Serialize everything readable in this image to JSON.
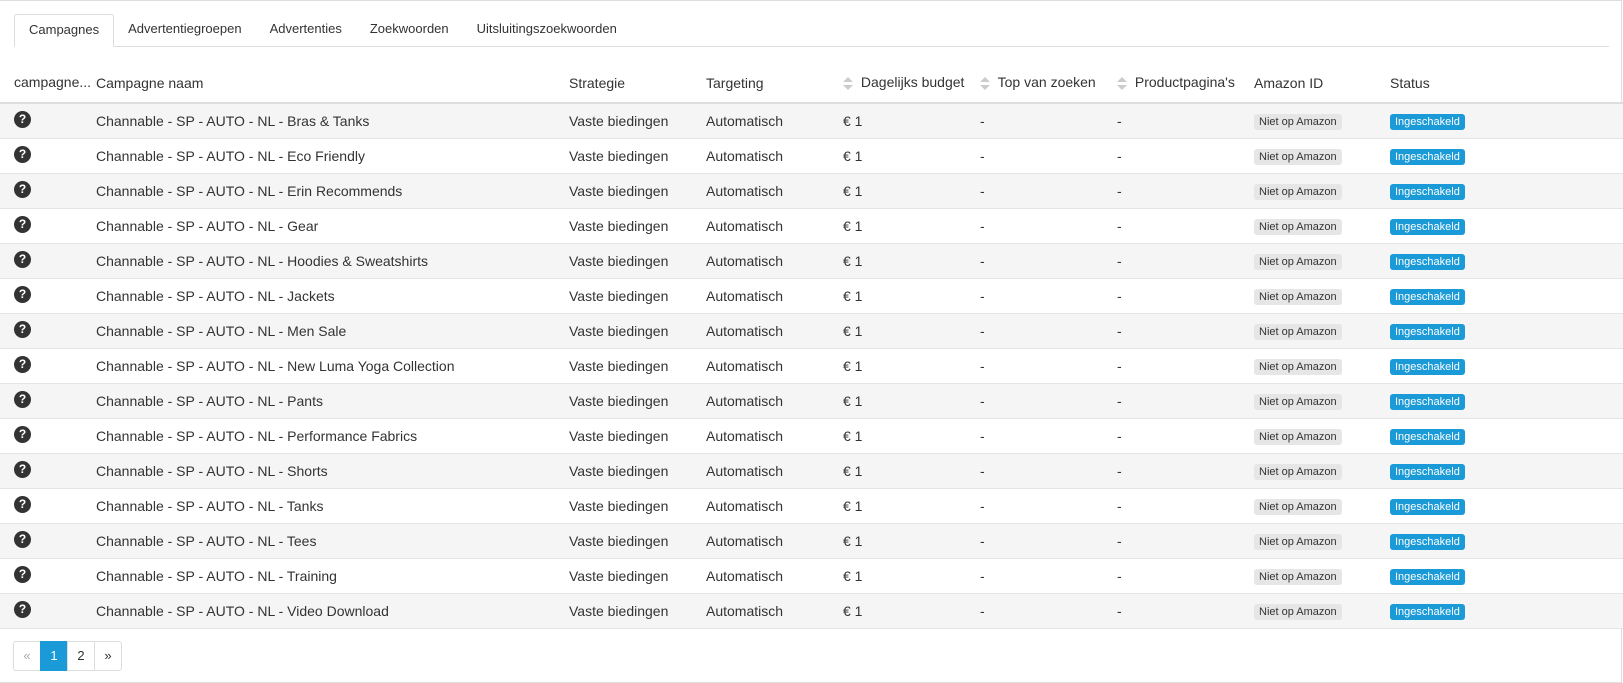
{
  "tabs": [
    "Campagnes",
    "Advertentiegroepen",
    "Advertenties",
    "Zoekwoorden",
    "Uitsluitingszoekwoorden"
  ],
  "active_tab": 0,
  "table": {
    "headers": {
      "type": "campagne...",
      "name": "Campagne naam",
      "strategy": "Strategie",
      "targeting": "Targeting",
      "budget": "Dagelijks budget",
      "top": "Top van zoeken",
      "product": "Productpagina's",
      "amazon": "Amazon ID",
      "status": "Status"
    },
    "rows": [
      {
        "icon": "?",
        "name": "Channable - SP - AUTO - NL - Bras & Tanks",
        "strategy": "Vaste biedingen",
        "targeting": "Automatisch",
        "budget": "€ 1",
        "top": "-",
        "product": "-",
        "amazon": "Niet op Amazon",
        "status": "Ingeschakeld"
      },
      {
        "icon": "?",
        "name": "Channable - SP - AUTO - NL - Eco Friendly",
        "strategy": "Vaste biedingen",
        "targeting": "Automatisch",
        "budget": "€ 1",
        "top": "-",
        "product": "-",
        "amazon": "Niet op Amazon",
        "status": "Ingeschakeld"
      },
      {
        "icon": "?",
        "name": "Channable - SP - AUTO - NL - Erin Recommends",
        "strategy": "Vaste biedingen",
        "targeting": "Automatisch",
        "budget": "€ 1",
        "top": "-",
        "product": "-",
        "amazon": "Niet op Amazon",
        "status": "Ingeschakeld"
      },
      {
        "icon": "?",
        "name": "Channable - SP - AUTO - NL - Gear",
        "strategy": "Vaste biedingen",
        "targeting": "Automatisch",
        "budget": "€ 1",
        "top": "-",
        "product": "-",
        "amazon": "Niet op Amazon",
        "status": "Ingeschakeld"
      },
      {
        "icon": "?",
        "name": "Channable - SP - AUTO - NL - Hoodies & Sweatshirts",
        "strategy": "Vaste biedingen",
        "targeting": "Automatisch",
        "budget": "€ 1",
        "top": "-",
        "product": "-",
        "amazon": "Niet op Amazon",
        "status": "Ingeschakeld"
      },
      {
        "icon": "?",
        "name": "Channable - SP - AUTO - NL - Jackets",
        "strategy": "Vaste biedingen",
        "targeting": "Automatisch",
        "budget": "€ 1",
        "top": "-",
        "product": "-",
        "amazon": "Niet op Amazon",
        "status": "Ingeschakeld"
      },
      {
        "icon": "?",
        "name": "Channable - SP - AUTO - NL - Men Sale",
        "strategy": "Vaste biedingen",
        "targeting": "Automatisch",
        "budget": "€ 1",
        "top": "-",
        "product": "-",
        "amazon": "Niet op Amazon",
        "status": "Ingeschakeld"
      },
      {
        "icon": "?",
        "name": "Channable - SP - AUTO - NL - New Luma Yoga Collection",
        "strategy": "Vaste biedingen",
        "targeting": "Automatisch",
        "budget": "€ 1",
        "top": "-",
        "product": "-",
        "amazon": "Niet op Amazon",
        "status": "Ingeschakeld"
      },
      {
        "icon": "?",
        "name": "Channable - SP - AUTO - NL - Pants",
        "strategy": "Vaste biedingen",
        "targeting": "Automatisch",
        "budget": "€ 1",
        "top": "-",
        "product": "-",
        "amazon": "Niet op Amazon",
        "status": "Ingeschakeld"
      },
      {
        "icon": "?",
        "name": "Channable - SP - AUTO - NL - Performance Fabrics",
        "strategy": "Vaste biedingen",
        "targeting": "Automatisch",
        "budget": "€ 1",
        "top": "-",
        "product": "-",
        "amazon": "Niet op Amazon",
        "status": "Ingeschakeld"
      },
      {
        "icon": "?",
        "name": "Channable - SP - AUTO - NL - Shorts",
        "strategy": "Vaste biedingen",
        "targeting": "Automatisch",
        "budget": "€ 1",
        "top": "-",
        "product": "-",
        "amazon": "Niet op Amazon",
        "status": "Ingeschakeld"
      },
      {
        "icon": "?",
        "name": "Channable - SP - AUTO - NL - Tanks",
        "strategy": "Vaste biedingen",
        "targeting": "Automatisch",
        "budget": "€ 1",
        "top": "-",
        "product": "-",
        "amazon": "Niet op Amazon",
        "status": "Ingeschakeld"
      },
      {
        "icon": "?",
        "name": "Channable - SP - AUTO - NL - Tees",
        "strategy": "Vaste biedingen",
        "targeting": "Automatisch",
        "budget": "€ 1",
        "top": "-",
        "product": "-",
        "amazon": "Niet op Amazon",
        "status": "Ingeschakeld"
      },
      {
        "icon": "?",
        "name": "Channable - SP - AUTO - NL - Training",
        "strategy": "Vaste biedingen",
        "targeting": "Automatisch",
        "budget": "€ 1",
        "top": "-",
        "product": "-",
        "amazon": "Niet op Amazon",
        "status": "Ingeschakeld"
      },
      {
        "icon": "?",
        "name": "Channable - SP - AUTO - NL - Video Download",
        "strategy": "Vaste biedingen",
        "targeting": "Automatisch",
        "budget": "€ 1",
        "top": "-",
        "product": "-",
        "amazon": "Niet op Amazon",
        "status": "Ingeschakeld"
      }
    ]
  },
  "pagination": {
    "prev": "«",
    "pages": [
      "1",
      "2"
    ],
    "current": "1",
    "next": "»"
  },
  "colors": {
    "accent": "#1a9ad6",
    "badge_gray": "#e6e6e6",
    "icon_dark": "#333333"
  }
}
